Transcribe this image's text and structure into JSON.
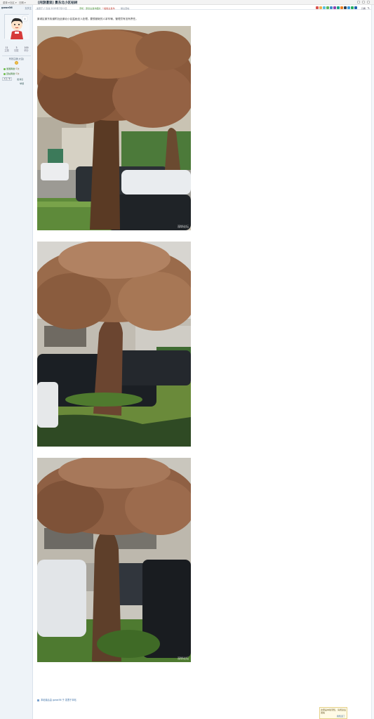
{
  "topbar": {
    "items": [
      "菜单 ▾",
      "社区 ▾",
      "日期 ▾"
    ]
  },
  "author": {
    "name": "gwoe36",
    "link": "加关注",
    "stats": [
      {
        "num": "11",
        "label": "主题"
      },
      {
        "num": "3",
        "label": "回复"
      },
      {
        "num": "100",
        "label": "积分"
      }
    ],
    "rank": "有效注册(大会)",
    "medals": [
      {
        "name": "爱国胸章",
        "count": "0次"
      },
      {
        "name": "回帖胸章",
        "count": "0次"
      }
    ],
    "actions": {
      "button": "关注 他",
      "msg": "发消息",
      "report": "举报"
    }
  },
  "post": {
    "title": "[闲游漫谈] 景东北小区枯树",
    "meta_time": "发表于 广东省 2019年7月11日",
    "tag1": "手机 · 原创主发布图片",
    "tag2": "一般版主发布",
    "tag3": "楼主回帖",
    "right_label": "只看",
    "content": "景城区景东街道附近此景北小区枯树无人处理。要想被砸的人拿车辆，管理员有没有责任。",
    "watermark": "深圳论坛",
    "attachment": "本帖最后由 gwoe36 于 发表于本帖"
  },
  "notice": {
    "text": "这里是本版须知，请阅读后发帖",
    "link": "我知道了"
  },
  "colors": {
    "accent": "#3a6ea5",
    "sidebar_bg": "#eef3f8",
    "medal_green": "#3a7a2e"
  },
  "icons": [
    "avatar-icon",
    "star-icon",
    "medal-icon",
    "share-icons",
    "pen-icon",
    "attachment-icon"
  ]
}
